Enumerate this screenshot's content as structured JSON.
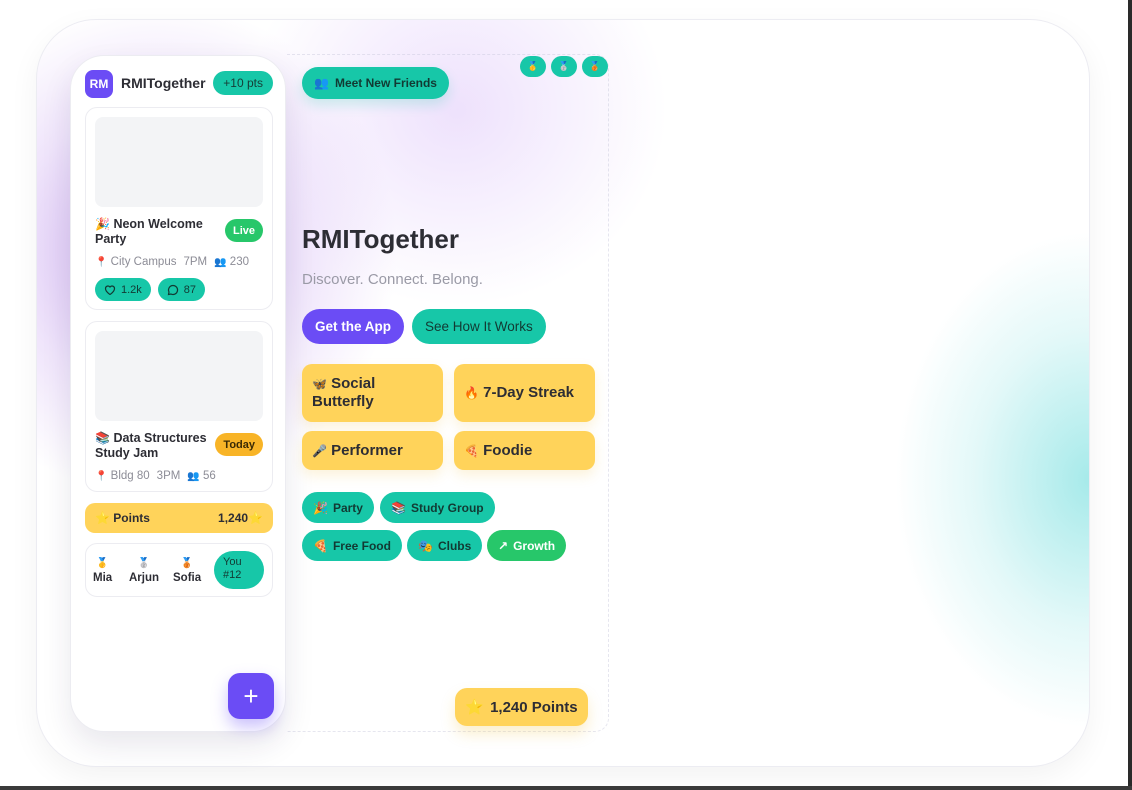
{
  "phone": {
    "logo": "RM",
    "brand": "RMITogether",
    "points_pill": "+10 pts",
    "events": [
      {
        "emoji": "🎉",
        "title": "Neon Welcome Party",
        "badge": "Live",
        "location": "City Campus",
        "time": "7PM",
        "attendees": "230",
        "likes": "1.2k",
        "comments": "87"
      },
      {
        "emoji": "📚",
        "title": "Data Structures Study Jam",
        "badge": "Today",
        "location": "Bldg 80",
        "time": "3PM",
        "attendees": "56"
      }
    ],
    "points_label": "Points",
    "points_value": "1,240",
    "leaderboard": [
      {
        "medal": "🥇",
        "name": "Mia"
      },
      {
        "medal": "🥈",
        "name": "Arjun"
      },
      {
        "medal": "🥉",
        "name": "Sofia"
      }
    ],
    "you_label": "You",
    "you_rank": "#12",
    "fab": "+"
  },
  "hero": {
    "meet_button": "Meet New Friends",
    "meet_emoji": "👥",
    "medals": [
      "🥇",
      "🥈",
      "🥉"
    ],
    "title": "RMITogether",
    "tagline": "Discover. Connect. Belong.",
    "primary_cta": "Get the App",
    "secondary_cta": "See How It Works",
    "achievements": [
      {
        "emoji": "🦋",
        "label": "Social Butterfly"
      },
      {
        "emoji": "🔥",
        "label": "7-Day Streak"
      },
      {
        "emoji": "🎤",
        "label": "Performer"
      },
      {
        "emoji": "🍕",
        "label": "Foodie"
      }
    ],
    "chips": [
      {
        "emoji": "🎉",
        "label": "Party"
      },
      {
        "emoji": "📚",
        "label": "Study Group"
      },
      {
        "emoji": "🍕",
        "label": "Free Food"
      },
      {
        "emoji": "🎭",
        "label": "Clubs"
      },
      {
        "emoji": "↗",
        "label": "Growth"
      }
    ],
    "points_badge": "1,240 Points",
    "points_badge_emoji": "⭐"
  },
  "colors": {
    "purple": "#6b4cf5",
    "teal": "#17c7a8",
    "yellow": "#ffd35a",
    "green": "#27c76a"
  }
}
